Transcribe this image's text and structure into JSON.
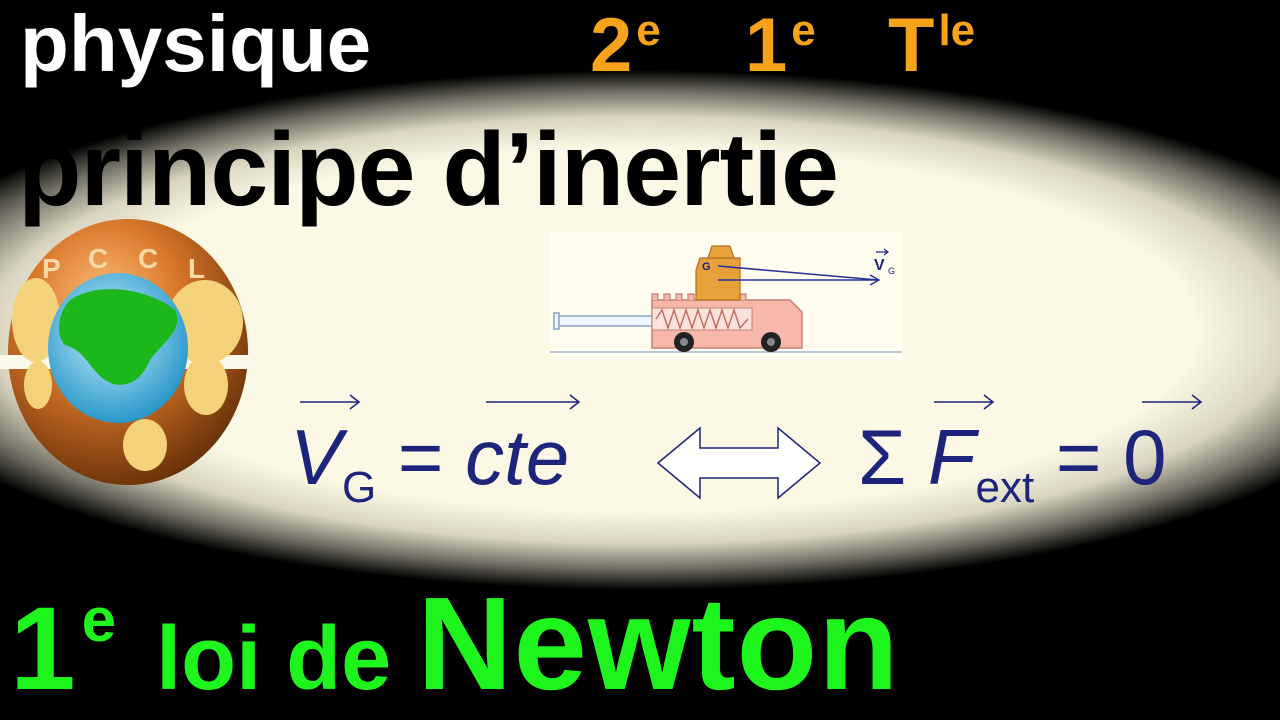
{
  "header": {
    "subject": "physique",
    "levels": [
      {
        "main": "2",
        "sup": "e"
      },
      {
        "main": "1",
        "sup": "e"
      },
      {
        "main": "T",
        "sup": "le"
      }
    ]
  },
  "title": "principe d’inertie",
  "logo": {
    "letters": [
      "P",
      "C",
      "C",
      "L"
    ]
  },
  "diagram": {
    "g_label": "G",
    "v_label": "V",
    "v_sub": "G"
  },
  "equation_left": {
    "var": "V",
    "sub": "G",
    "rest": " = ",
    "value": "cte"
  },
  "equation_right": {
    "sigma": "Σ",
    "var": "F",
    "sub": "ext",
    "rest": " = 0"
  },
  "footer": {
    "num": "1",
    "sup": "e",
    "middle": "loi de",
    "name": "Newton"
  },
  "colors": {
    "accent_orange": "#f6a21a",
    "accent_green": "#1df51d",
    "equation_blue": "#1c247c",
    "background_cream": "#fbf8e6"
  }
}
